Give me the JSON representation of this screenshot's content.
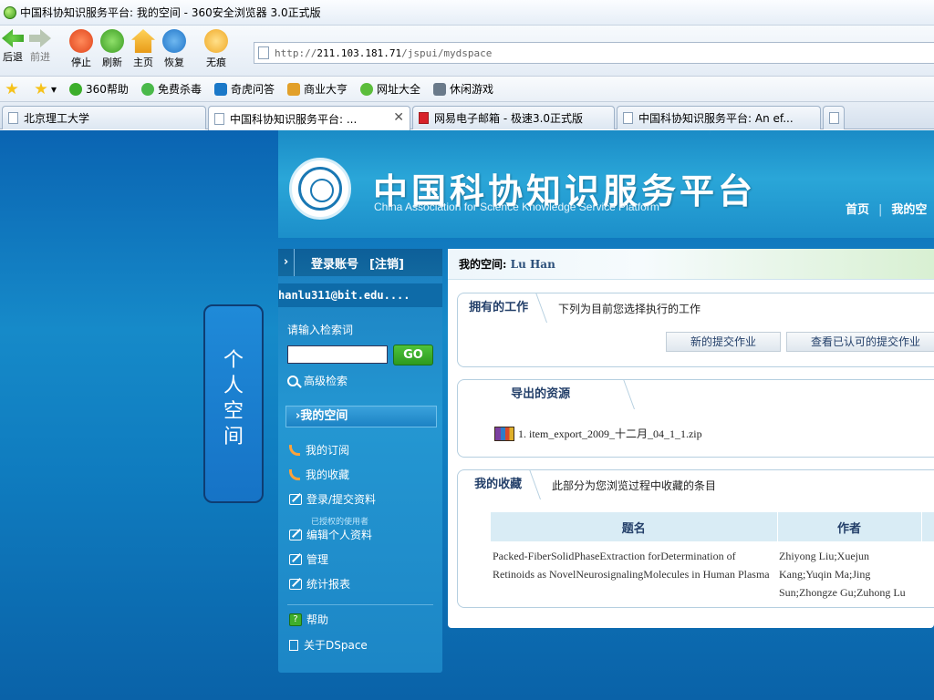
{
  "browser": {
    "window_title": "中国科协知识服务平台: 我的空间 - 360安全浏览器 3.0正式版",
    "nav": {
      "back": "后退",
      "forward": "前进",
      "stop": "停止",
      "refresh": "刷新",
      "home": "主页",
      "restore": "恢复",
      "incognito": "无痕"
    },
    "address": {
      "scheme": "http://",
      "host": "211.103.181.71",
      "path": "/jspui/mydspace"
    },
    "favorites": [
      "360帮助",
      "免费杀毒",
      "奇虎问答",
      "商业大亨",
      "网址大全",
      "休闲游戏"
    ],
    "tabs": [
      {
        "label": "北京理工大学"
      },
      {
        "label": "中国科协知识服务平台: ...",
        "close": "✕"
      },
      {
        "label": "网易电子邮箱 - 极速3.0正式版"
      },
      {
        "label": "中国科协知识服务平台: An ef..."
      }
    ]
  },
  "site": {
    "title": "中国科协知识服务平台",
    "subtitle": "China Association for Science Knowledge Service Platform",
    "topnav": [
      "首页",
      "我的空"
    ]
  },
  "personal_panel": {
    "chars": [
      "个",
      "人",
      "空",
      "间"
    ]
  },
  "sidebar": {
    "arrow": "›",
    "login_label": "登录账号",
    "logout_label": "[注销]",
    "user": "hanlu311@bit.edu....",
    "search_label": "请输入检索词",
    "search_value": "",
    "go": "GO",
    "advanced": "高级检索",
    "section": "›我的空间",
    "items": [
      "我的订阅",
      "我的收藏",
      "登录/提交资料",
      "编辑个人资料",
      "管理",
      "统计报表",
      "帮助",
      "关于DSpace"
    ],
    "small_note": "已授权的使用者"
  },
  "main": {
    "space_label": "我的空间:",
    "user_name": "Lu Han",
    "owned": {
      "title": "拥有的工作",
      "desc": "下列为目前您选择执行的工作",
      "btn_new": "新的提交作业",
      "btn_view": "查看已认可的提交作业"
    },
    "exports": {
      "title": "导出的资源",
      "item": "1. item_export_2009_十二月_04_1_1.zip"
    },
    "favorites": {
      "title": "我的收藏",
      "desc": "此部分为您浏览过程中收藏的条目",
      "col_title": "题名",
      "col_author": "作者",
      "rows": [
        {
          "title": "Packed-FiberSolidPhaseExtraction forDetermination of Retinoids as NovelNeurosignalingMolecules in Human Plasma",
          "author": "Zhiyong Liu;Xuejun Kang;Yuqin Ma;Jing Sun;Zhongze Gu;Zuhong Lu"
        }
      ]
    }
  }
}
